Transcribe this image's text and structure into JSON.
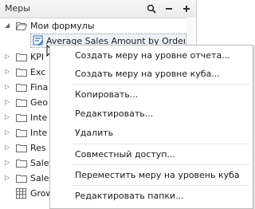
{
  "panel": {
    "title": "Меры",
    "buttons": [
      {
        "icon": "search-icon"
      },
      {
        "icon": "minus-icon"
      },
      {
        "icon": "plus-icon"
      }
    ]
  },
  "tree": {
    "root": {
      "label": "Мои формулы",
      "expanded": true
    },
    "selected": {
      "label": "Average Sales Amount by Order"
    },
    "folders": [
      "KPI",
      "Exc",
      "Fina",
      "Geo",
      "Inte",
      "Inte",
      "Res",
      "Sale",
      "Sale"
    ],
    "last_item": {
      "label": "Grow"
    }
  },
  "context_menu": {
    "items": [
      {
        "label": "Создать меру на уровне отчета..."
      },
      {
        "label": "Создать меру на уровне куба..."
      },
      {
        "label": "Копировать..."
      },
      {
        "label": "Редактировать..."
      },
      {
        "label": "Удалить"
      },
      {
        "label": "Совместный доступ..."
      },
      {
        "label": "Переместить меру на уровень куба"
      },
      {
        "label": "Редактировать папки..."
      }
    ]
  },
  "colors": {
    "folder_stroke": "#6a6a6a",
    "calc_icon_blue": "#2f6db5",
    "menu_border": "#bdbdbd"
  }
}
